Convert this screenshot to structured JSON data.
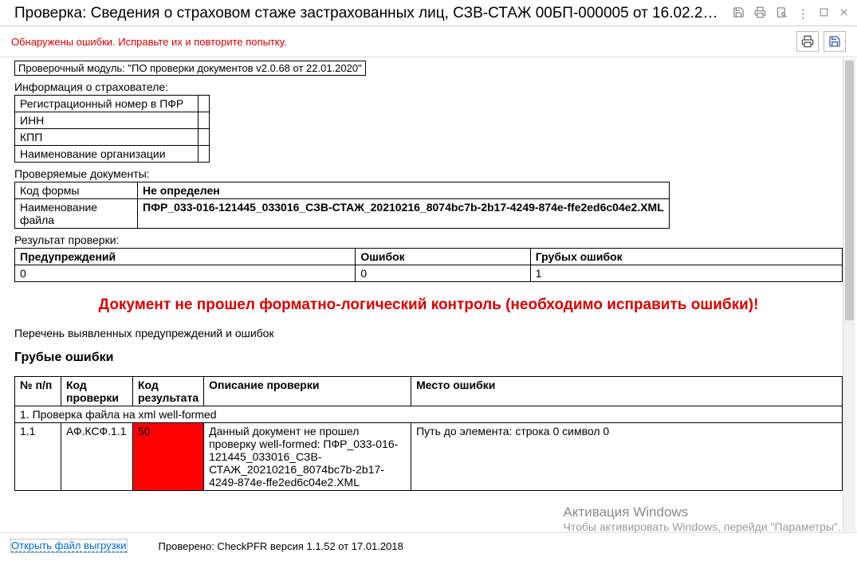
{
  "titlebar": {
    "title": "Проверка: Сведения о страховом стаже застрахованных лиц, СЗВ-СТАЖ 00БП-000005 от 16.02.2…"
  },
  "toolbar": {
    "error_banner": "Обнаружены ошибки. Исправьте их и повторите попытку."
  },
  "module_line": "Проверочный модуль: \"ПО проверки документов v2.0.68 от 22.01.2020\"",
  "insurer": {
    "heading": "Информация о страхователе:",
    "rows": {
      "r1": "Регистрационный номер в ПФР",
      "r2": "ИНН",
      "r3": "КПП",
      "r4": "Наименование организации"
    }
  },
  "docs": {
    "heading": "Проверяемые документы:",
    "row1_label": "Код формы",
    "row1_value": "Не определен",
    "row2_label": "Наименование файла",
    "row2_value": "ПФР_033-016-121445_033016_СЗВ-СТАЖ_20210216_8074bc7b-2b17-4249-874e-ffe2ed6c04e2.XML"
  },
  "result": {
    "heading": "Результат проверки:",
    "h1": "Предупреждений",
    "h2": "Ошибок",
    "h3": "Грубых ошибок",
    "v1": "0",
    "v2": "0",
    "v3": "1"
  },
  "fail_message": "Документ не прошел форматно-логический контроль (необходимо исправить ошибки)!",
  "list_heading": "Перечень выявленных предупреждений и ошибок",
  "gross_heading": "Грубые ошибки",
  "err_table": {
    "h_n": "№ п/п",
    "h_code": "Код проверки",
    "h_res": "Код результата",
    "h_desc": "Описание проверки",
    "h_place": "Место ошибки",
    "group1": "1. Проверка файла на xml well-formed",
    "row1": {
      "n": "1.1",
      "code": "АФ.КСФ.1.1",
      "res": "50",
      "desc": "Данный документ не прошел проверку well-formed: ПФР_033-016-121445_033016_СЗВ-СТАЖ_20210216_8074bc7b-2b17-4249-874e-ffe2ed6c04e2.XML",
      "place": "Путь до элемента: строка 0 символ 0"
    }
  },
  "footer": {
    "link": "Открыть файл выгрузки",
    "checked": "Проверено: CheckPFR версия 1.1.52 от 17.01.2018"
  },
  "watermark": {
    "title": "Активация Windows",
    "line": "Чтобы активировать Windows, перейди \"Параметры\"."
  }
}
